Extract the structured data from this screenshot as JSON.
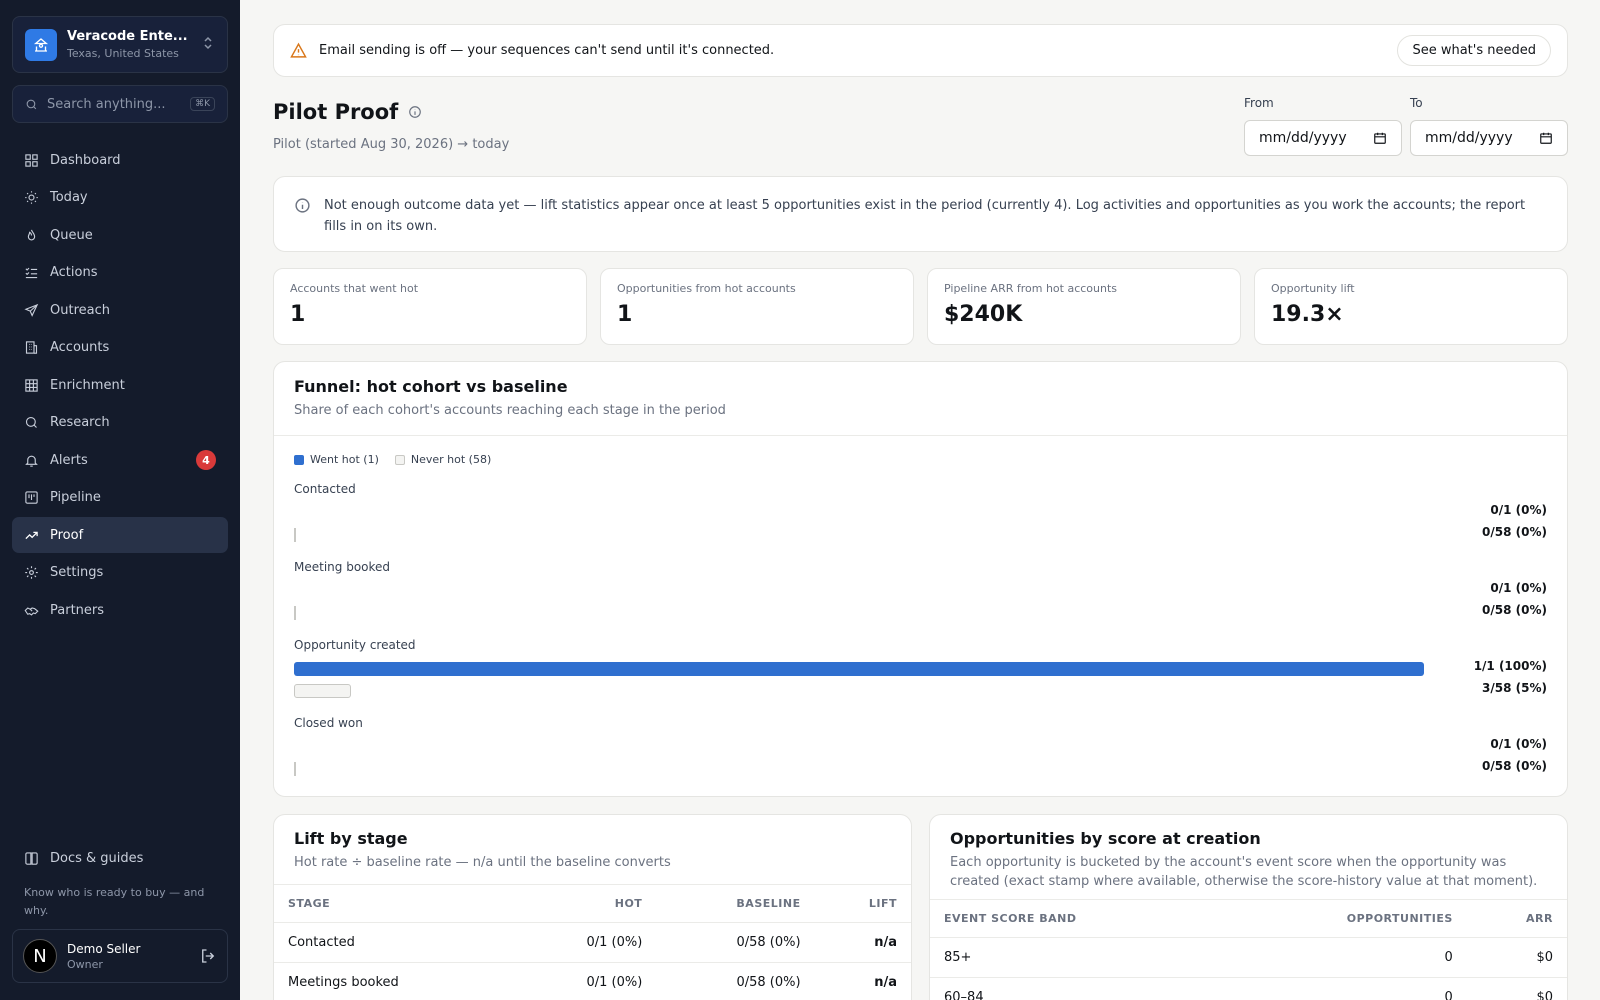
{
  "org": {
    "name": "Veracode Ente...",
    "location": "Texas, United States"
  },
  "search": {
    "placeholder": "Search anything...",
    "shortcut": "⌘K"
  },
  "nav": [
    {
      "label": "Dashboard",
      "icon": "dashboard-icon"
    },
    {
      "label": "Today",
      "icon": "sun-icon"
    },
    {
      "label": "Queue",
      "icon": "flame-icon"
    },
    {
      "label": "Actions",
      "icon": "list-check-icon"
    },
    {
      "label": "Outreach",
      "icon": "send-icon"
    },
    {
      "label": "Accounts",
      "icon": "building-icon"
    },
    {
      "label": "Enrichment",
      "icon": "grid-icon"
    },
    {
      "label": "Research",
      "icon": "search-icon"
    },
    {
      "label": "Alerts",
      "icon": "bell-icon",
      "badge": "4"
    },
    {
      "label": "Pipeline",
      "icon": "kanban-icon"
    },
    {
      "label": "Proof",
      "icon": "trending-up-icon",
      "active": true
    },
    {
      "label": "Settings",
      "icon": "gear-icon"
    },
    {
      "label": "Partners",
      "icon": "handshake-icon"
    }
  ],
  "footer": {
    "docs_label": "Docs & guides",
    "tagline": "Know who is ready to buy — and why.",
    "user_name": "Demo Seller",
    "user_role": "Owner",
    "avatar_letter": "N"
  },
  "banner": {
    "text": "Email sending is off — your sequences can't send until it's connected.",
    "button": "See what's needed"
  },
  "page": {
    "title": "Pilot Proof",
    "subtitle": "Pilot (started Aug 30, 2026) → today",
    "from_label": "From",
    "to_label": "To",
    "from_value": "mm/dd/yyyy",
    "to_value": "mm/dd/yyyy"
  },
  "notice": "Not enough outcome data yet — lift statistics appear once at least 5 opportunities exist in the period (currently 4). Log activities and opportunities as you work the accounts; the report fills in on its own.",
  "kpis": [
    {
      "label": "Accounts that went hot",
      "value": "1"
    },
    {
      "label": "Opportunities from hot accounts",
      "value": "1"
    },
    {
      "label": "Pipeline ARR from hot accounts",
      "value": "$240K"
    },
    {
      "label": "Opportunity lift",
      "value": "19.3×"
    }
  ],
  "funnel": {
    "title": "Funnel: hot cohort vs baseline",
    "subtitle": "Share of each cohort's accounts reaching each stage in the period",
    "legend_hot": "Went hot (1)",
    "legend_base": "Never hot (58)",
    "colors": {
      "hot": "#2f6fcf",
      "baseline": "#f4f4f2"
    },
    "stages": [
      {
        "label": "Contacted",
        "hot_label": "0/1 (0%)",
        "hot_pct": 0,
        "base_label": "0/58 (0%)",
        "base_pct": 0
      },
      {
        "label": "Meeting booked",
        "hot_label": "0/1 (0%)",
        "hot_pct": 0,
        "base_label": "0/58 (0%)",
        "base_pct": 0
      },
      {
        "label": "Opportunity created",
        "hot_label": "1/1 (100%)",
        "hot_pct": 100,
        "base_label": "3/58 (5%)",
        "base_pct": 5
      },
      {
        "label": "Closed won",
        "hot_label": "0/1 (0%)",
        "hot_pct": 0,
        "base_label": "0/58 (0%)",
        "base_pct": 0
      }
    ]
  },
  "lift": {
    "title": "Lift by stage",
    "subtitle": "Hot rate ÷ baseline rate — n/a until the baseline converts",
    "headers": [
      "STAGE",
      "HOT",
      "BASELINE",
      "LIFT"
    ],
    "rows": [
      [
        "Contacted",
        "0/1 (0%)",
        "0/58 (0%)",
        "n/a"
      ],
      [
        "Meetings booked",
        "0/1 (0%)",
        "0/58 (0%)",
        "n/a"
      ]
    ]
  },
  "score": {
    "title": "Opportunities by score at creation",
    "subtitle": "Each opportunity is bucketed by the account's event score when the opportunity was created (exact stamp where available, otherwise the score-history value at that moment).",
    "headers": [
      "EVENT SCORE BAND",
      "OPPORTUNITIES",
      "ARR"
    ],
    "rows": [
      [
        "85+",
        "0",
        "$0"
      ],
      [
        "60–84",
        "0",
        "$0"
      ]
    ]
  }
}
